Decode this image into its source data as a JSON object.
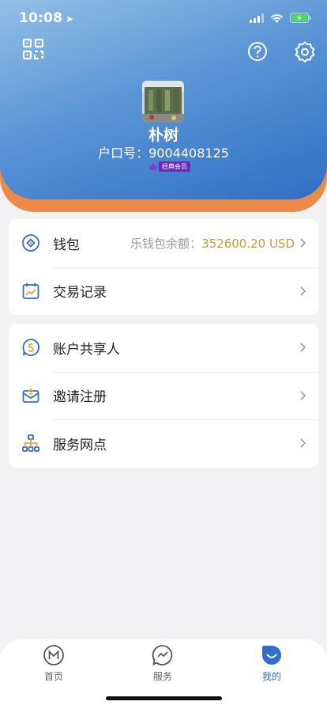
{
  "status_bar": {
    "time": "10:08",
    "location_arrow": "location-arrow-icon"
  },
  "header": {
    "icons": [
      "qr-scan-icon",
      "help-icon",
      "settings-icon"
    ],
    "user_name": "朴树",
    "account_label": "户口号：",
    "account_number": "9004408125",
    "badge_text": "经典会员"
  },
  "wallet_card": {
    "wallet": {
      "label": "钱包",
      "balance_label": "乐钱包余额：",
      "balance_value": "352600.20 USD",
      "icon": "wallet-icon"
    },
    "transactions": {
      "label": "交易记录",
      "icon": "chart-calendar-icon"
    }
  },
  "service_card": {
    "items": [
      {
        "label": "账户共享人",
        "icon": "share-account-icon"
      },
      {
        "label": "邀请注册",
        "icon": "invite-envelope-icon"
      },
      {
        "label": "服务网点",
        "icon": "network-icon"
      }
    ]
  },
  "tabbar": {
    "tabs": [
      {
        "label": "首页",
        "icon": "home-m-icon",
        "active": false
      },
      {
        "label": "服务",
        "icon": "service-chat-icon",
        "active": false
      },
      {
        "label": "我的",
        "icon": "mine-smile-icon",
        "active": true
      }
    ]
  },
  "colors": {
    "accent_blue": "#2f6fc4",
    "header_orange": "#ec8a4a",
    "balance_gold": "#c99a3a",
    "badge_purple": "#6a2bb6"
  }
}
